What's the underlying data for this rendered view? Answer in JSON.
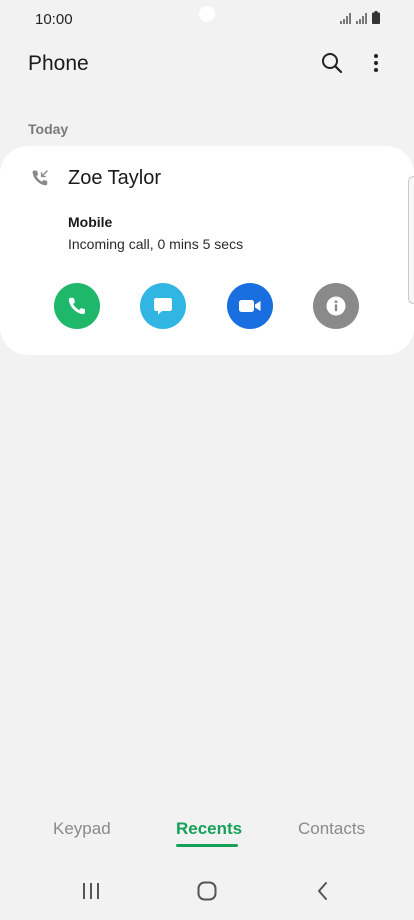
{
  "status_bar": {
    "time": "10:00"
  },
  "app_bar": {
    "title": "Phone",
    "search_icon": "search-icon",
    "more_icon": "more-vertical-icon"
  },
  "recents": {
    "section_label": "Today",
    "entries": [
      {
        "name": "Zoe Taylor",
        "call_type_icon": "incoming-call-icon",
        "number_type": "Mobile",
        "detail": "Incoming call, 0 mins 5 secs",
        "actions": [
          {
            "icon": "phone-icon",
            "color": "#1fb86a"
          },
          {
            "icon": "message-icon",
            "color": "#31b6e3"
          },
          {
            "icon": "video-call-icon",
            "color": "#1a6fe0"
          },
          {
            "icon": "info-icon",
            "color": "#8a8a8a"
          }
        ]
      }
    ]
  },
  "bottom_tabs": {
    "items": [
      {
        "label": "Keypad",
        "active": false
      },
      {
        "label": "Recents",
        "active": true
      },
      {
        "label": "Contacts",
        "active": false
      }
    ],
    "active_color": "#16a05a"
  },
  "nav_bar": {
    "recent_apps_icon": "recent-apps-icon",
    "home_icon": "home-icon",
    "back_icon": "back-icon"
  }
}
